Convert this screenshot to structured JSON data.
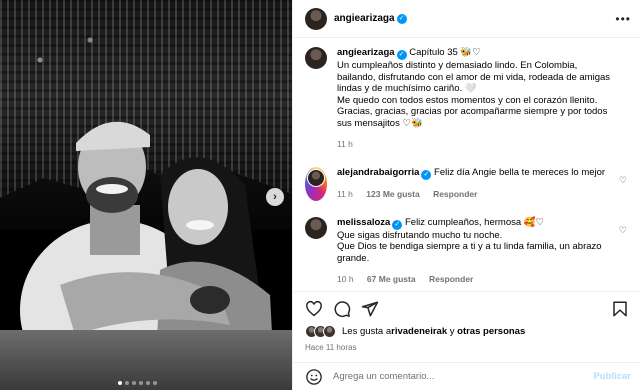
{
  "header": {
    "username": "angiearizaga",
    "more_icon": "more-horizontal-icon"
  },
  "caption": {
    "username": "angiearizaga",
    "lines": [
      "Capítulo 35 🐝♡",
      "Un cumpleaños distinto y demasiado lindo. En Colombia,",
      "bailando, disfrutando con el amor de mi vida, rodeada de amigas",
      "lindas y de muchísimo cariño. 🤍",
      "Me quedo con todos estos momentos y con el corazón llenito.",
      "Gracias, gracias, gracias por acompañarme siempre y por todos",
      "sus mensajitos ♡🐝"
    ],
    "time": "11 h"
  },
  "comments": [
    {
      "username": "alejandrabaigorria",
      "verified": true,
      "lines": [
        "Feliz día Angie bella te mereces lo mejor"
      ],
      "time": "11 h",
      "likes": "123 Me gusta",
      "reply": "Responder"
    },
    {
      "username": "melissaloza",
      "verified": true,
      "lines": [
        "Feliz cumpleaños, hermosa 🥰♡",
        "Que sigas disfrutando mucho tu noche.",
        "Que Dios te bendiga siempre a ti y a tu linda familia, un abrazo",
        "grande."
      ],
      "time": "10 h",
      "likes": "67 Me gusta",
      "reply": "Responder"
    }
  ],
  "likes": {
    "prefix": "Les gusta a ",
    "user": "rivadeneirak",
    "middle": " y ",
    "others": "otras personas"
  },
  "posted": "Hace 11 horas",
  "add_comment": {
    "placeholder": "Agrega un comentario...",
    "publish": "Publicar",
    "emoji_icon": "emoji-icon"
  },
  "carousel": {
    "dots": 6,
    "active": 0,
    "next_icon": "chevron-right-icon"
  },
  "colors": {
    "link_blue": "#0095f6",
    "publish_disabled": "#b2dffc",
    "meta_gray": "#737373"
  }
}
